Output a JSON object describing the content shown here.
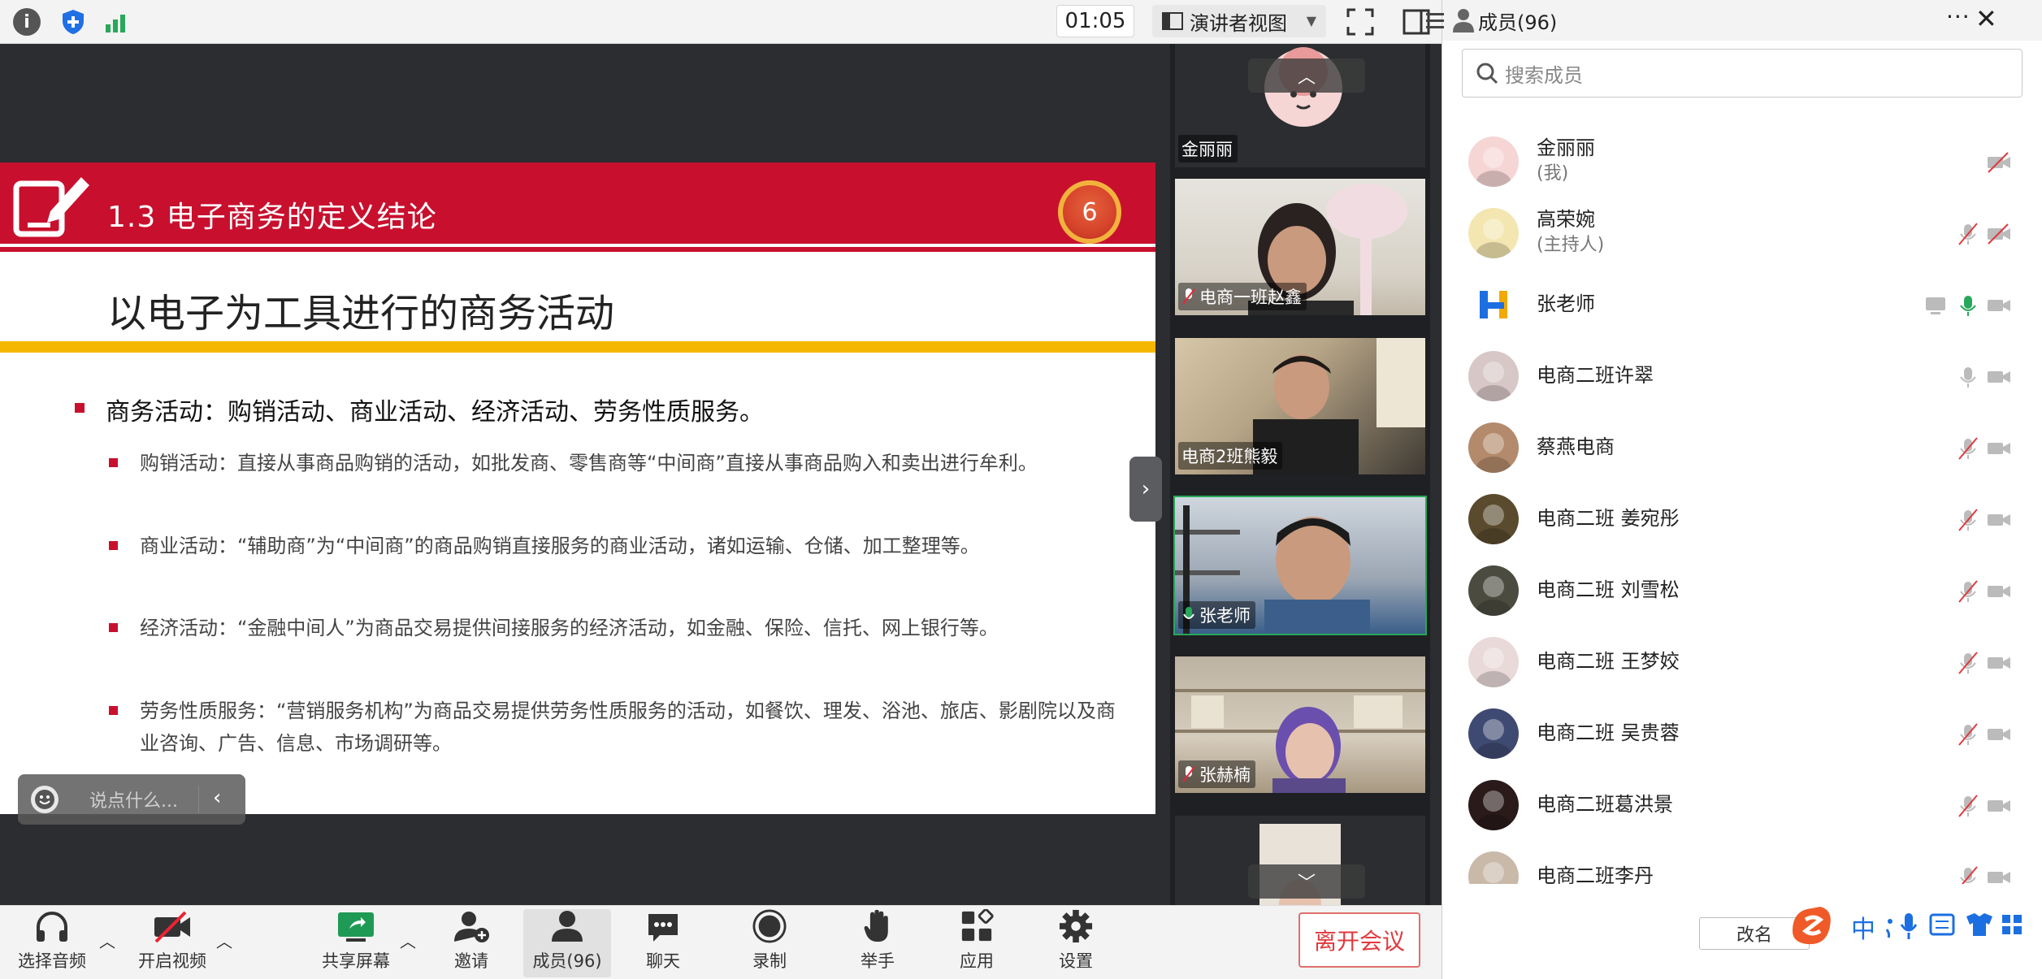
{
  "topbar": {
    "timer": "01:05",
    "view_mode": "演讲者视图"
  },
  "slide": {
    "section": "1.3  电子商务的定义结论",
    "page_number": "6",
    "title": "以电子为工具进行的商务活动",
    "main_bullet": "商务活动：购销活动、商业活动、经济活动、劳务性质服务。",
    "sub_bullets": [
      "购销活动：直接从事商品购销的活动，如批发商、零售商等“中间商”直接从事商品购入和卖出进行牟利。",
      "商业活动：“辅助商”为“中间商”的商品购销直接服务的商业活动，诸如运输、仓储、加工整理等。",
      "经济活动：“金融中间人”为商品交易提供间接服务的经济活动，如金融、保险、信托、网上银行等。",
      "劳务性质服务：“营销服务机构”为商品交易提供劳务性质服务的活动，如餐饮、理发、浴池、旅店、影剧院以及商业咨询、广告、信息、市场调研等。"
    ]
  },
  "chat": {
    "placeholder": "说点什么..."
  },
  "videos": [
    {
      "name": "金丽丽"
    },
    {
      "name": "电商一班赵鑫"
    },
    {
      "name": "电商2班熊毅"
    },
    {
      "name": "张老师"
    },
    {
      "name": "张赫楠"
    },
    {
      "name": ""
    }
  ],
  "toolbar": {
    "audio": "选择音频",
    "video": "开启视频",
    "share": "共享屏幕",
    "invite": "邀请",
    "members": "成员(96)",
    "chat": "聊天",
    "record": "录制",
    "raise_hand": "举手",
    "apps": "应用",
    "settings": "设置",
    "leave": "离开会议"
  },
  "members_panel": {
    "title": "成员(96)",
    "search_placeholder": "搜索成员",
    "change_label": "改名",
    "members": [
      {
        "name": "金丽丽",
        "role": "(我)"
      },
      {
        "name": "高荣婉",
        "role": "(主持人)"
      },
      {
        "name": "张老师",
        "role": ""
      },
      {
        "name": "电商二班许翠",
        "role": ""
      },
      {
        "name": "蔡燕电商",
        "role": ""
      },
      {
        "name": "电商二班 姜宛彤",
        "role": ""
      },
      {
        "name": "电商二班 刘雪松",
        "role": ""
      },
      {
        "name": "电商二班 王梦姣",
        "role": ""
      },
      {
        "name": "电商二班 吴贵蓉",
        "role": ""
      },
      {
        "name": "电商二班葛洪景",
        "role": ""
      },
      {
        "name": "电商二班李丹",
        "role": ""
      }
    ]
  },
  "ime": {
    "lang_label": "中"
  },
  "colors": {
    "slide_red": "#c8102e",
    "slide_yellow": "#f5b800",
    "leave_red": "#e0393e",
    "mic_active": "#27a85a"
  }
}
